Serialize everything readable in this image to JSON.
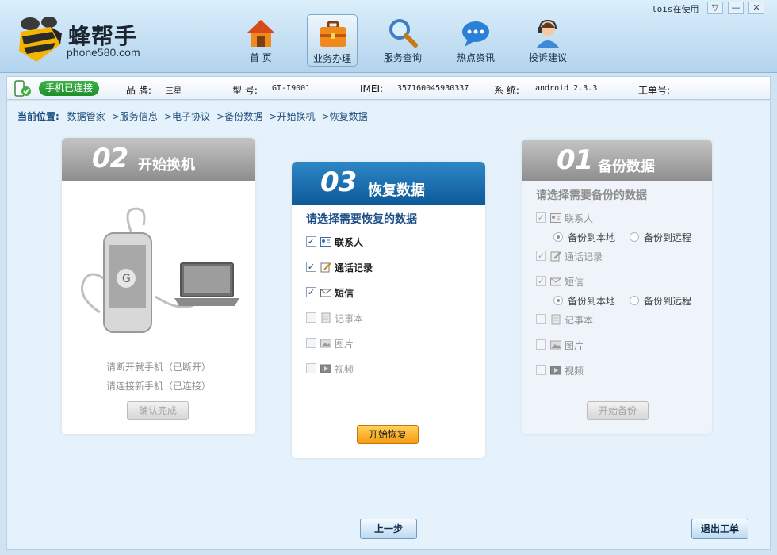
{
  "header": {
    "brand": "蜂帮手",
    "brand_sub": "phone580.com",
    "user": "lois在使用",
    "sys": {
      "menu": "▽",
      "min": "—",
      "close": "✕"
    },
    "nav": [
      {
        "label": "首 页",
        "icon": "house-icon"
      },
      {
        "label": "业务办理",
        "icon": "briefcase-icon"
      },
      {
        "label": "服务查询",
        "icon": "magnifier-icon"
      },
      {
        "label": "热点资讯",
        "icon": "chat-bubble-icon"
      },
      {
        "label": "投诉建议",
        "icon": "support-agent-icon"
      }
    ]
  },
  "infobar": {
    "status": "手机已连接",
    "brand_label": "品 牌:",
    "brand_value": "三星",
    "model_label": "型 号:",
    "model_value": "GT-I9001",
    "imei_label": "IMEI:",
    "imei_value": "357160045930337",
    "system_label": "系 统:",
    "system_value": "android 2.3.3",
    "ticket_label": "工单号:"
  },
  "breadcrumb": {
    "label": "当前位置:",
    "path": "数据管家 ->服务信息 ->电子协议 ->备份数据 ->开始换机 ->恢复数据"
  },
  "step2": {
    "num": "02",
    "title": "开始换机",
    "line1": "请断开就手机（已断开）",
    "line2": "请连接新手机（已连接）",
    "confirm": "确认完成"
  },
  "step3": {
    "num": "03",
    "title": "恢复数据",
    "prompt": "请选择需要恢复的数据",
    "items": [
      {
        "label": "联系人",
        "checked": "✓"
      },
      {
        "label": "通话记录",
        "checked": "✓"
      },
      {
        "label": "短信",
        "checked": "✓"
      },
      {
        "label": "记事本",
        "checked": ""
      },
      {
        "label": "图片",
        "checked": ""
      },
      {
        "label": "视频",
        "checked": ""
      }
    ],
    "start": "开始恢复"
  },
  "step1": {
    "num": "01",
    "title": "备份数据",
    "prompt": "请选择需要备份的数据",
    "items": [
      {
        "label": "联系人",
        "checked": "✓"
      },
      {
        "label": "通话记录",
        "checked": "✓"
      },
      {
        "label": "短信",
        "checked": "✓"
      },
      {
        "label": "记事本",
        "checked": ""
      },
      {
        "label": "图片",
        "checked": ""
      },
      {
        "label": "视频",
        "checked": ""
      }
    ],
    "local": "备份到本地",
    "remote": "备份到远程",
    "start": "开始备份"
  },
  "footer": {
    "prev": "上一步",
    "exit": "退出工单"
  },
  "colors": {
    "accent": "#0f5a98",
    "connected": "#1d8d2a",
    "orange": "#f79a10"
  }
}
